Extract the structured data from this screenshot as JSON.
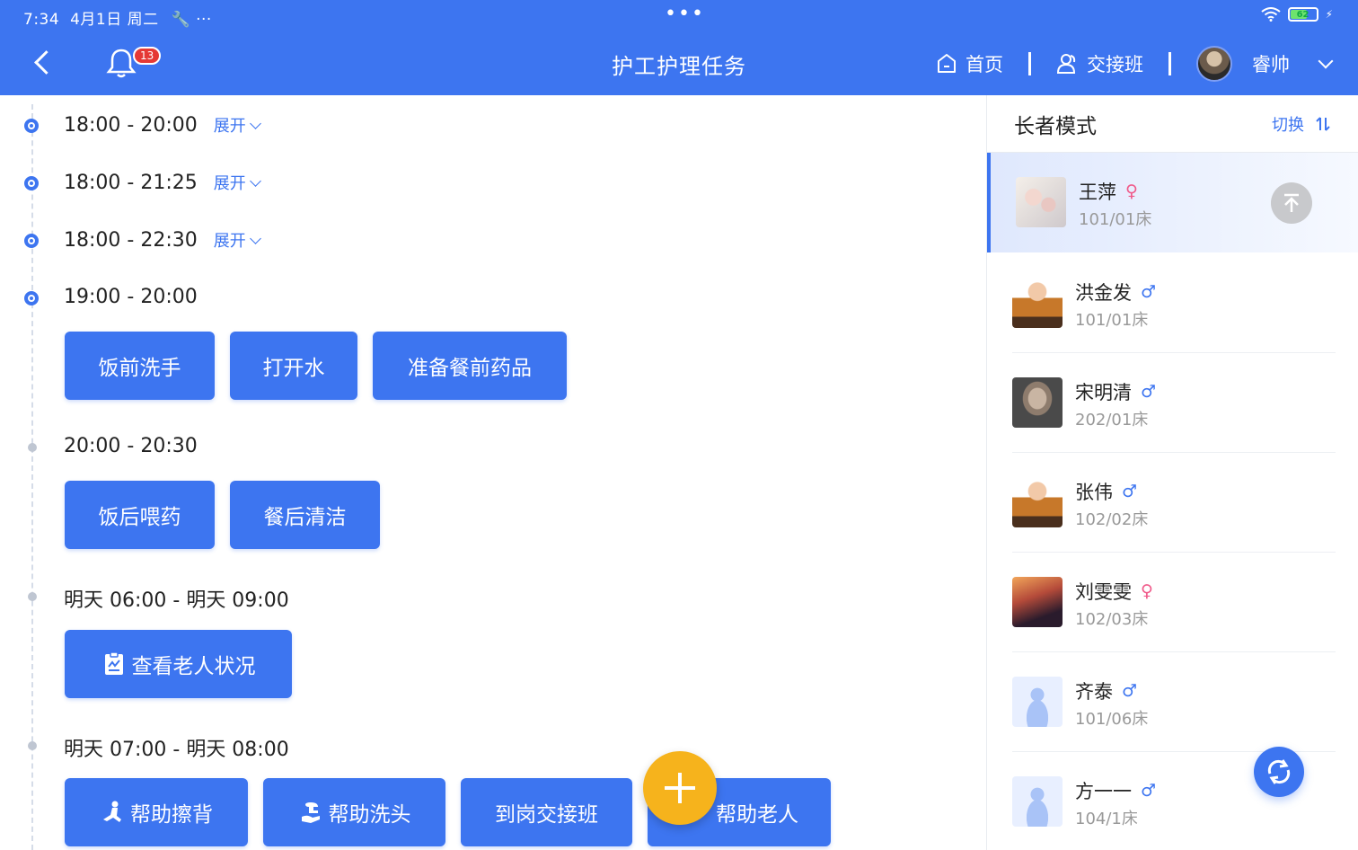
{
  "status_bar": {
    "time": "7:34",
    "date": "4月1日 周二",
    "dots": "•••",
    "battery": "62"
  },
  "header": {
    "title": "护工护理任务",
    "badge": "13",
    "home": "首页",
    "handover": "交接班",
    "user": "睿帅"
  },
  "timeline": {
    "expand_label": "展开",
    "slots": [
      {
        "time": "18:00 - 20:00"
      },
      {
        "time": "18:00 - 21:25"
      },
      {
        "time": "18:00 - 22:30"
      },
      {
        "time": "19:00 - 20:00",
        "tasks": [
          "饭前洗手",
          "打开水",
          "准备餐前药品"
        ]
      },
      {
        "time": "20:00 - 20:30",
        "tasks": [
          "饭后喂药",
          "餐后清洁"
        ]
      },
      {
        "time": "明天 06:00 - 明天 09:00",
        "tasks": [
          "查看老人状况"
        ]
      },
      {
        "time": "明天 07:00 - 明天 08:00",
        "tasks": [
          "帮助擦背",
          "帮助洗头",
          "到岗交接班",
          "帮助老人"
        ]
      }
    ]
  },
  "panel": {
    "title": "长者模式",
    "switch_label": "切换",
    "residents": [
      {
        "name": "王萍",
        "gender": "♀",
        "bed": "101/01床"
      },
      {
        "name": "洪金发",
        "gender": "♂",
        "bed": "101/01床"
      },
      {
        "name": "宋明清",
        "gender": "♂",
        "bed": "202/01床"
      },
      {
        "name": "张伟",
        "gender": "♂",
        "bed": "102/02床"
      },
      {
        "name": "刘雯雯",
        "gender": "♀",
        "bed": "102/03床"
      },
      {
        "name": "齐泰",
        "gender": "♂",
        "bed": "101/06床"
      },
      {
        "name": "方一一",
        "gender": "♂",
        "bed": "104/1床"
      }
    ]
  },
  "colors": {
    "primary": "#3d75f0",
    "fab": "#f6b31c",
    "female": "#f05a8a"
  }
}
